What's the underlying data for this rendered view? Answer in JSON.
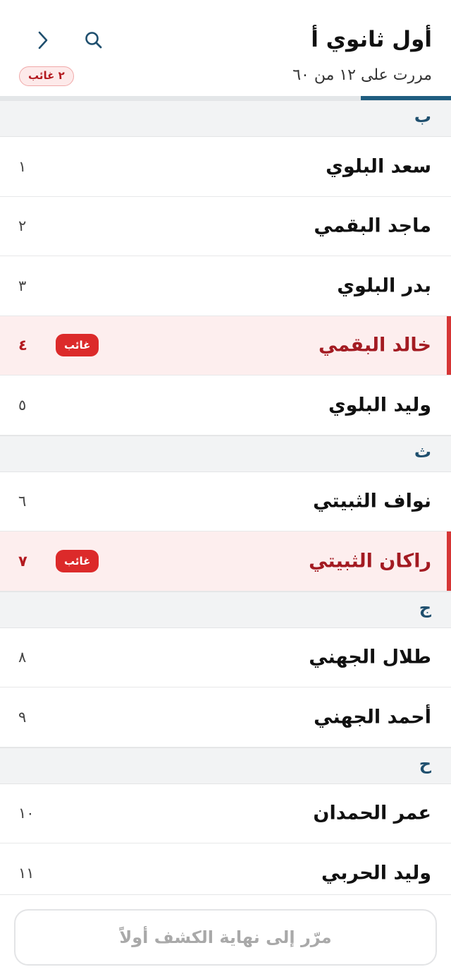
{
  "header": {
    "title": "أول ثانوي أ",
    "progress_text": "مررت على ١٢ من ٦٠",
    "absent_pill": "٢ غائب",
    "progress_fraction": 0.2
  },
  "icons": {
    "forward": "chevron-right-icon",
    "search": "search-icon"
  },
  "colors": {
    "accent": "#1f5d80",
    "absent": "#dc2a2a",
    "absent_bg": "#fdeeee"
  },
  "list": [
    {
      "type": "section",
      "letter": "ب"
    },
    {
      "type": "row",
      "name": "سعد البلوي",
      "number": "١"
    },
    {
      "type": "row",
      "name": "ماجد البقمي",
      "number": "٢"
    },
    {
      "type": "row",
      "name": "بدر البلوي",
      "number": "٣"
    },
    {
      "type": "row",
      "name": "خالد البقمي",
      "number": "٤",
      "badge": "غائب",
      "absent": true
    },
    {
      "type": "row",
      "name": "وليد البلوي",
      "number": "٥"
    },
    {
      "type": "section",
      "letter": "ث"
    },
    {
      "type": "row",
      "name": "نواف الثبيتي",
      "number": "٦"
    },
    {
      "type": "row",
      "name": "راكان الثبيتي",
      "number": "٧",
      "badge": "غائب",
      "absent": true
    },
    {
      "type": "section",
      "letter": "ج"
    },
    {
      "type": "row",
      "name": "طلال الجهني",
      "number": "٨"
    },
    {
      "type": "row",
      "name": "أحمد الجهني",
      "number": "٩"
    },
    {
      "type": "section",
      "letter": "ح"
    },
    {
      "type": "row",
      "name": "عمر الحمدان",
      "number": "١٠"
    },
    {
      "type": "row",
      "name": "وليد الحربي",
      "number": "١١"
    }
  ],
  "footer": {
    "button_label": "مرّر إلى نهاية الكشف أولاً"
  }
}
